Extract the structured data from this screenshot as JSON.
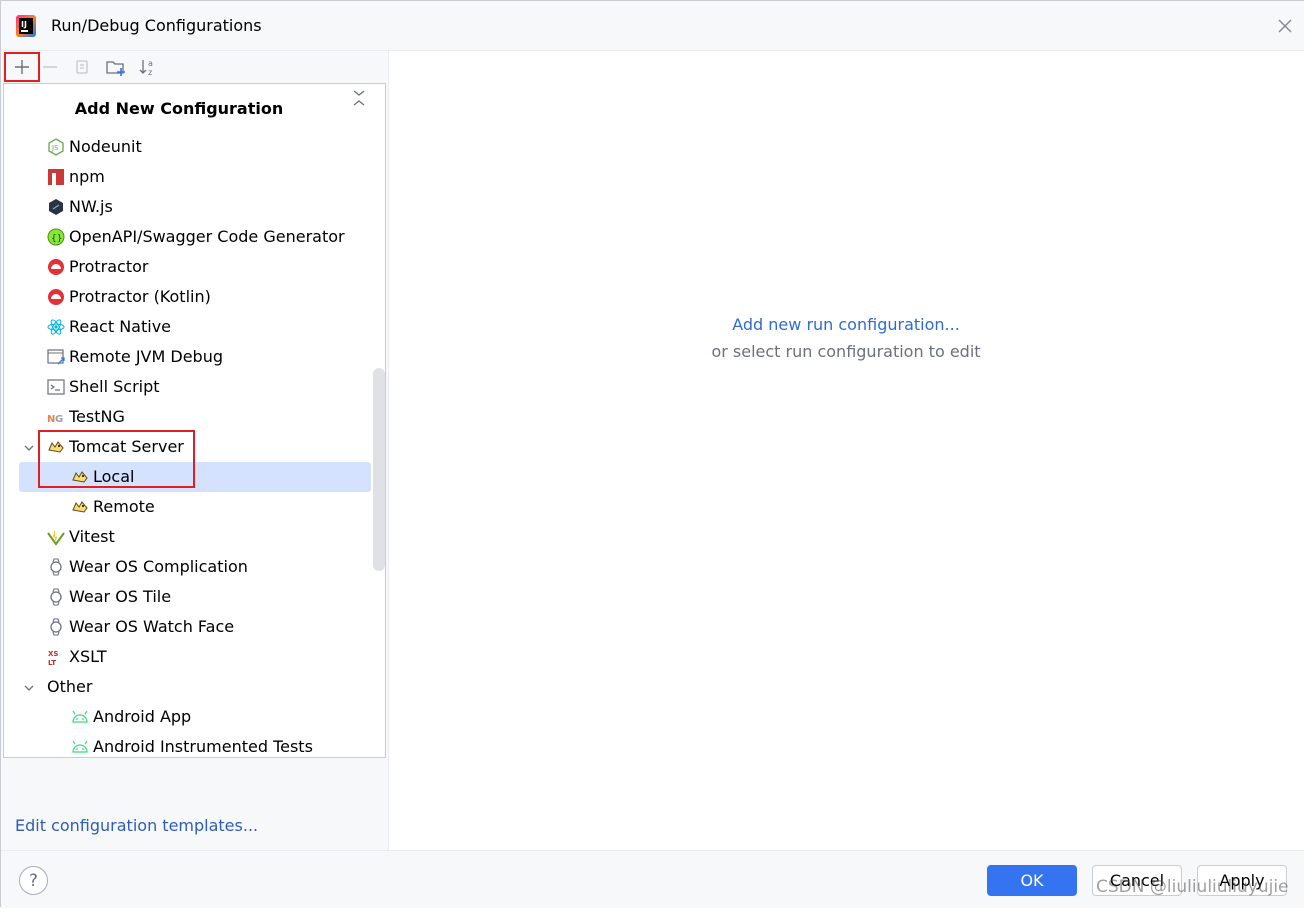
{
  "window": {
    "title": "Run/Debug Configurations"
  },
  "toolbar": {
    "add": "add-icon",
    "remove": "minus-icon",
    "copy": "copy-icon",
    "new_folder": "folder-add-icon",
    "sort": "sort-alpha-icon"
  },
  "popup": {
    "title": "Add New Configuration",
    "items": [
      {
        "label": "Nodeunit",
        "icon": "nodeunit-icon"
      },
      {
        "label": "npm",
        "icon": "npm-icon"
      },
      {
        "label": "NW.js",
        "icon": "nwjs-icon"
      },
      {
        "label": "OpenAPI/Swagger Code Generator",
        "icon": "openapi-icon"
      },
      {
        "label": "Protractor",
        "icon": "protractor-icon"
      },
      {
        "label": "Protractor (Kotlin)",
        "icon": "protractor-icon"
      },
      {
        "label": "React Native",
        "icon": "react-icon"
      },
      {
        "label": "Remote JVM Debug",
        "icon": "remote-debug-icon"
      },
      {
        "label": "Shell Script",
        "icon": "terminal-icon"
      },
      {
        "label": "TestNG",
        "icon": "testng-icon"
      },
      {
        "label": "Tomcat Server",
        "icon": "tomcat-icon",
        "expanded": true
      },
      {
        "label": "Local",
        "icon": "tomcat-icon",
        "selected": true
      },
      {
        "label": "Remote",
        "icon": "tomcat-icon"
      },
      {
        "label": "Vitest",
        "icon": "vitest-icon"
      },
      {
        "label": "Wear OS Complication",
        "icon": "watch-icon"
      },
      {
        "label": "Wear OS Tile",
        "icon": "watch-icon"
      },
      {
        "label": "Wear OS Watch Face",
        "icon": "watch-icon"
      },
      {
        "label": "XSLT",
        "icon": "xslt-icon"
      },
      {
        "label": "Other",
        "icon": "",
        "expanded": true
      },
      {
        "label": "Android App",
        "icon": "android-icon"
      },
      {
        "label": "Android Instrumented Tests",
        "icon": "android-icon"
      }
    ]
  },
  "left_footer": {
    "edit_templates": "Edit configuration templates..."
  },
  "right": {
    "add_link": "Add new run configuration...",
    "hint": "or select run configuration to edit"
  },
  "footer": {
    "help": "?",
    "ok": "OK",
    "cancel": "Cancel",
    "apply": "Apply",
    "watermark": "CSDN @liuliuliuliuyujie"
  },
  "colors": {
    "accent": "#3574f0",
    "link": "#2f6bd0",
    "selection": "#d4e2ff",
    "highlight_box": "#e02020"
  }
}
